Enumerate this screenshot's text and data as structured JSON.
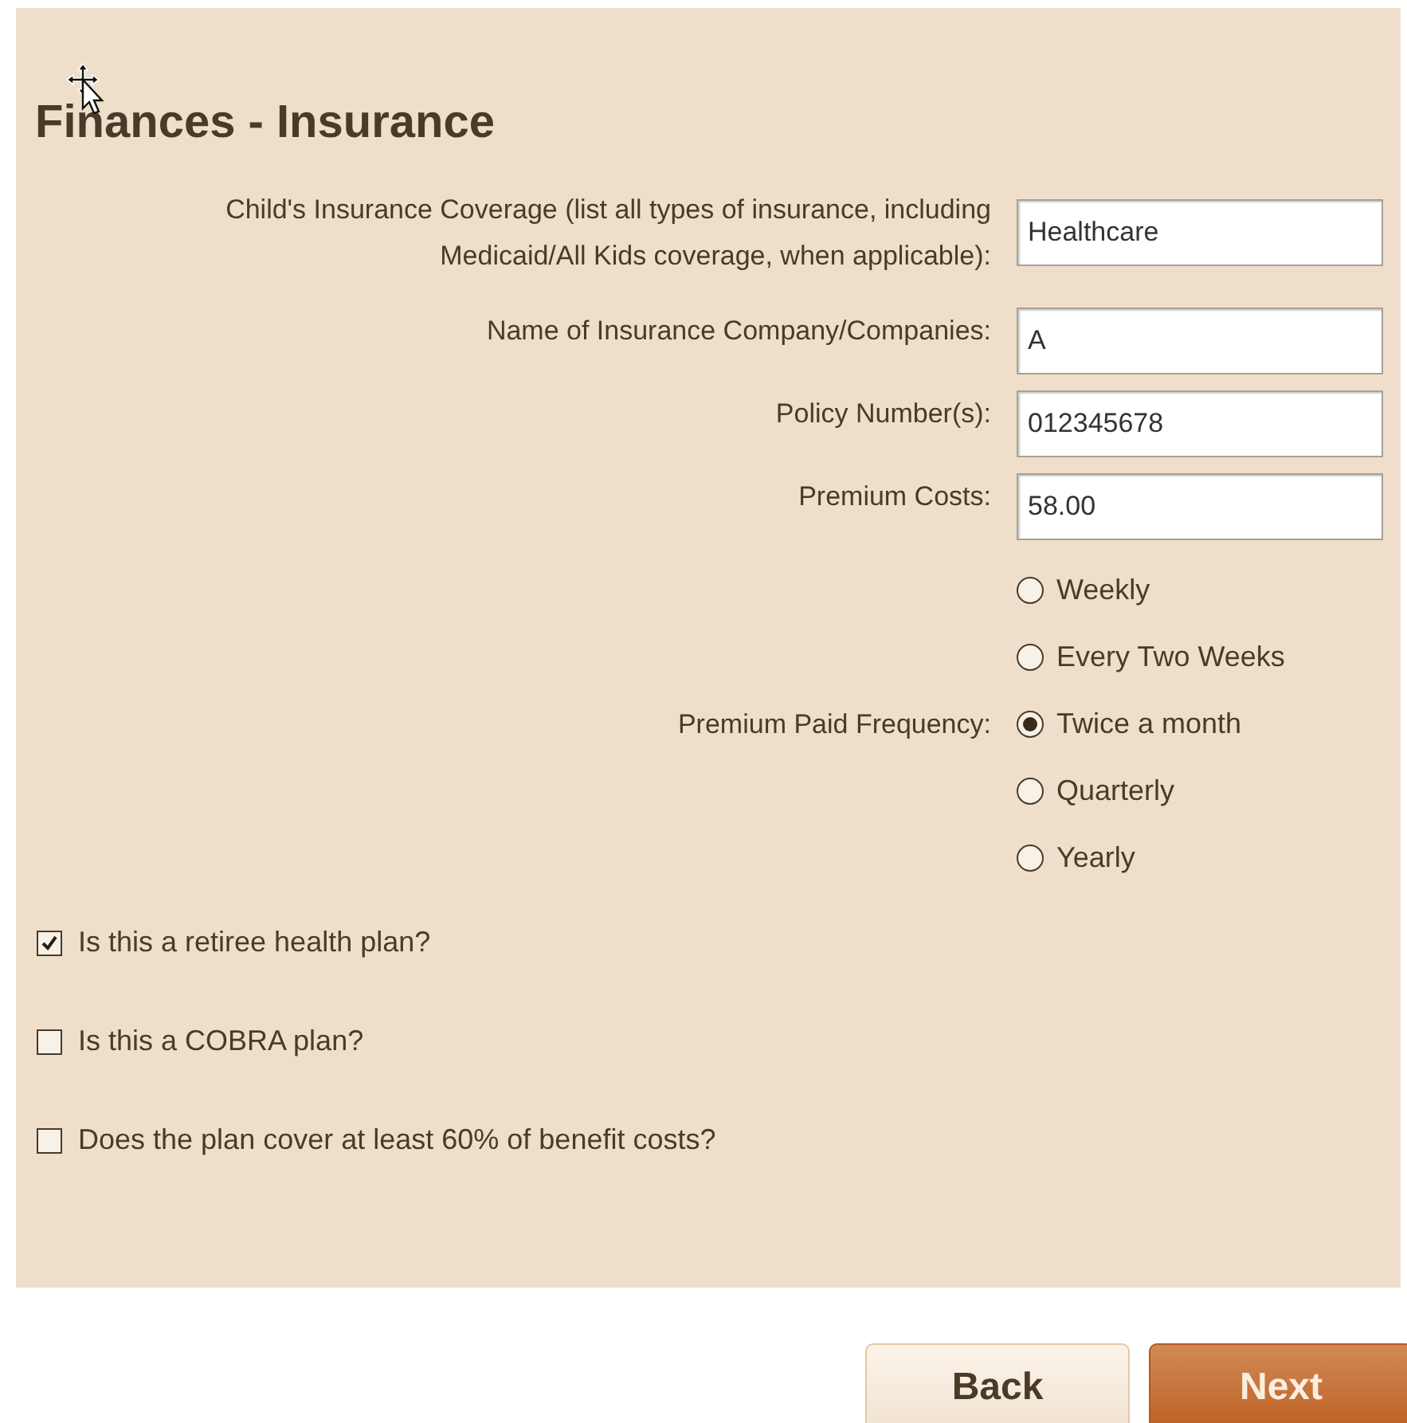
{
  "title": "Finances - Insurance",
  "fields": [
    {
      "label": "Child's Insurance Coverage (list all types of insurance, including Medicaid/All Kids coverage, when applicable):",
      "value": "Healthcare"
    },
    {
      "label": "Name of Insurance Company/Companies:",
      "value": "A"
    },
    {
      "label": "Policy Number(s):",
      "value": "012345678"
    },
    {
      "label": "Premium Costs:",
      "value": "58.00"
    }
  ],
  "frequency": {
    "label": "Premium Paid Frequency:",
    "options": [
      {
        "label": "Weekly",
        "selected": false
      },
      {
        "label": "Every Two Weeks",
        "selected": false
      },
      {
        "label": "Twice a month",
        "selected": true
      },
      {
        "label": "Quarterly",
        "selected": false
      },
      {
        "label": "Yearly",
        "selected": false
      }
    ]
  },
  "checkboxes": [
    {
      "label": "Is this a retiree health plan?",
      "checked": true
    },
    {
      "label": "Is this a COBRA plan?",
      "checked": false
    },
    {
      "label": "Does the plan cover at least 60% of benefit costs?",
      "checked": false
    }
  ],
  "buttons": [
    {
      "label": "Back",
      "kind": "secondary"
    },
    {
      "label": "Next",
      "kind": "primary"
    }
  ]
}
